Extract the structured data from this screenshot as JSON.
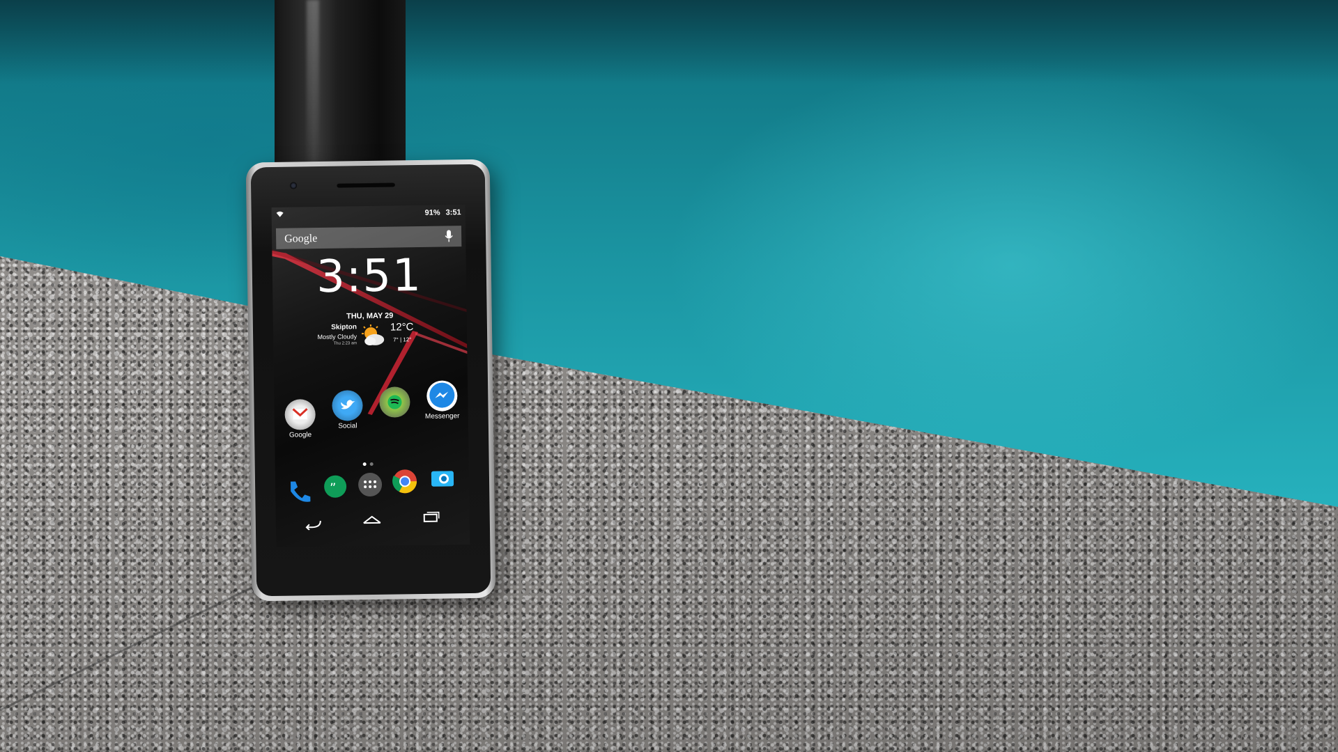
{
  "phone": {
    "status": {
      "battery": "91%",
      "time": "3:51"
    },
    "search": {
      "logo": "Google"
    },
    "clock_widget": {
      "time": "3:51",
      "date": "THU, MAY 29"
    },
    "weather": {
      "location": "Skipton",
      "condition": "Mostly Cloudy",
      "updated": "Thu 2:23 am",
      "temperature": "12°C",
      "range": "7° | 12°"
    },
    "apps": [
      {
        "label": "Google"
      },
      {
        "label": "Social"
      },
      {
        "label": ""
      },
      {
        "label": "Messenger"
      }
    ],
    "dock": [
      "phone-icon",
      "hangouts-icon",
      "app-drawer-icon",
      "chrome-icon",
      "camera-icon"
    ],
    "navigation": [
      "back-icon",
      "home-icon",
      "recents-icon"
    ]
  },
  "colors": {
    "wallpaper_accent": "#e8283a",
    "pool": "#2bb9c3"
  }
}
